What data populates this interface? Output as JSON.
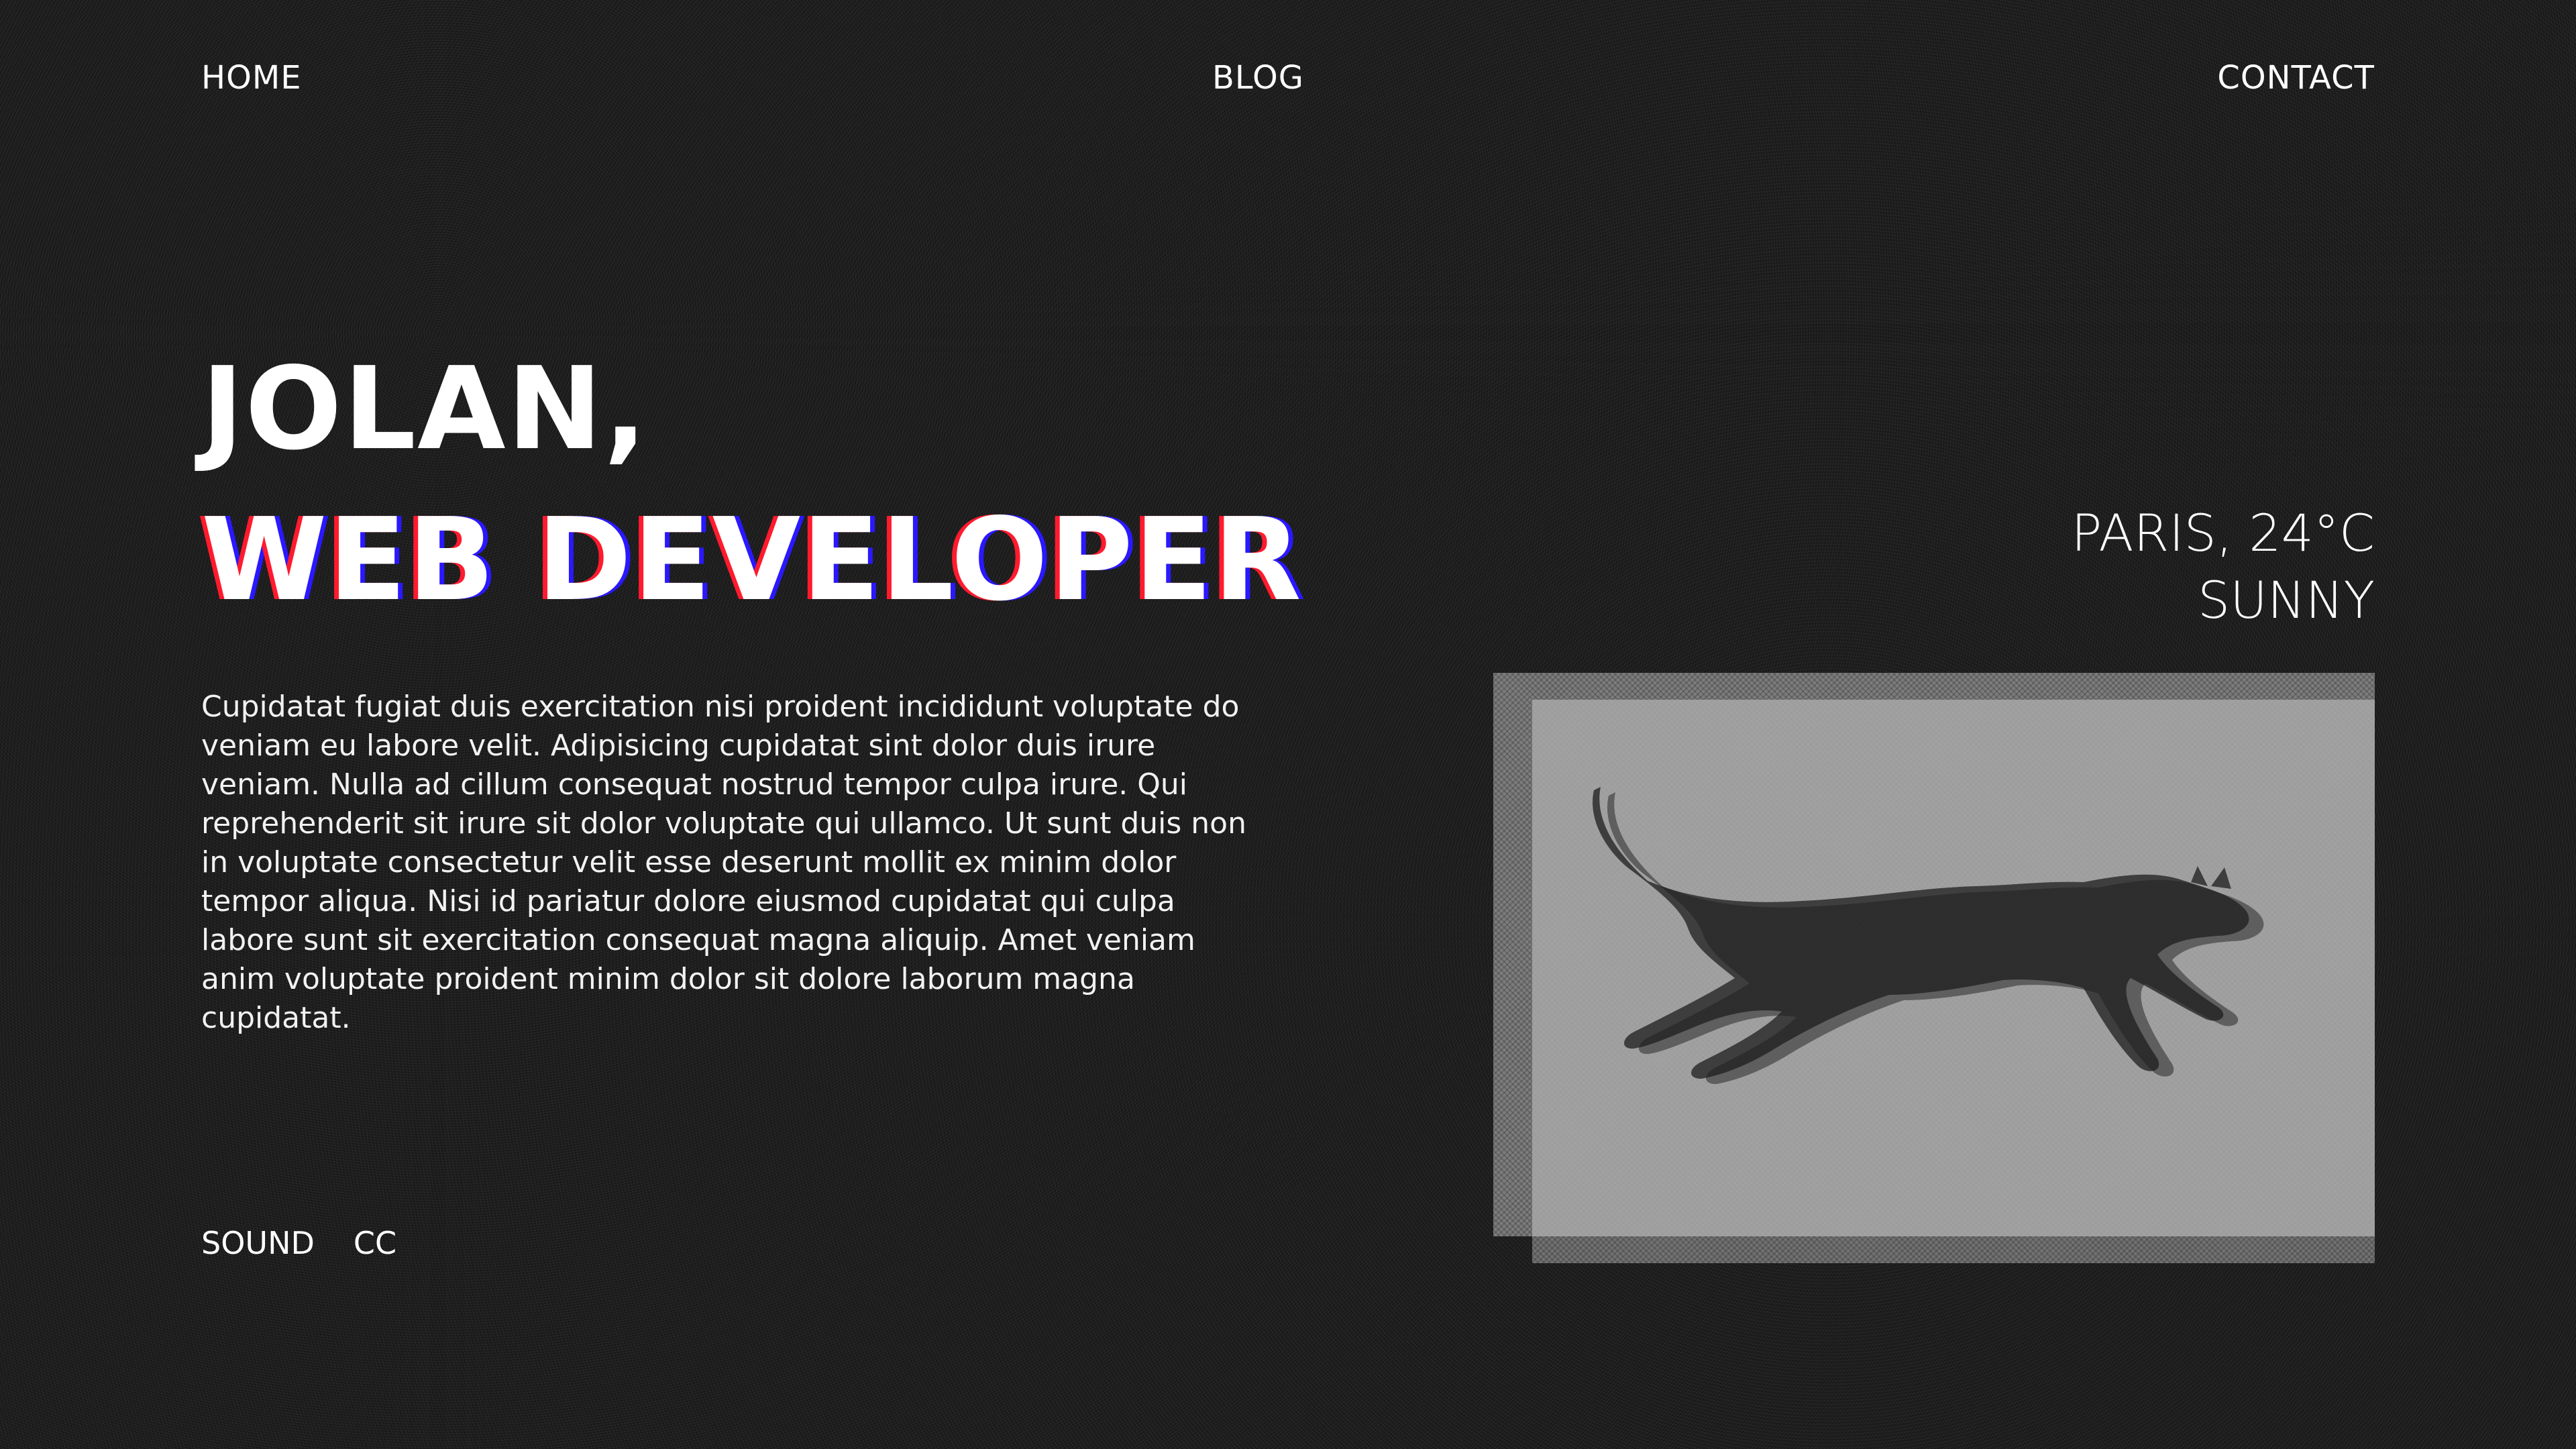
{
  "nav": {
    "home": "HOME",
    "blog": "BLOG",
    "contact": "CONTACT"
  },
  "hero": {
    "name": "JOLAN,",
    "role": "WEB DEVELOPER",
    "intro": "Cupidatat fugiat duis exercitation nisi proident incididunt voluptate do veniam eu labore velit. Adipisicing cupidatat sint dolor duis irure veniam. Nulla ad cillum consequat nostrud tempor culpa irure. Qui reprehenderit sit irure sit dolor voluptate qui ullamco. Ut sunt duis non in voluptate consectetur velit esse deserunt mollit ex minim dolor tempor aliqua. Nisi id pariatur dolore eiusmod cupidatat qui culpa labore sunt sit exercitation consequat magna aliquip. Amet veniam anim voluptate proident minim dolor sit dolore laborum magna cupidatat."
  },
  "controls": {
    "sound": "SOUND",
    "cc": "CC"
  },
  "weather": {
    "location_temp": "PARIS, 24°C",
    "condition": "SUNNY"
  },
  "photo": {
    "subject": "running-cat-image"
  },
  "colors": {
    "background": "#151515",
    "text": "#ffffff",
    "glitch_red": "#ff1a2e",
    "glitch_blue": "#2a18ff"
  }
}
